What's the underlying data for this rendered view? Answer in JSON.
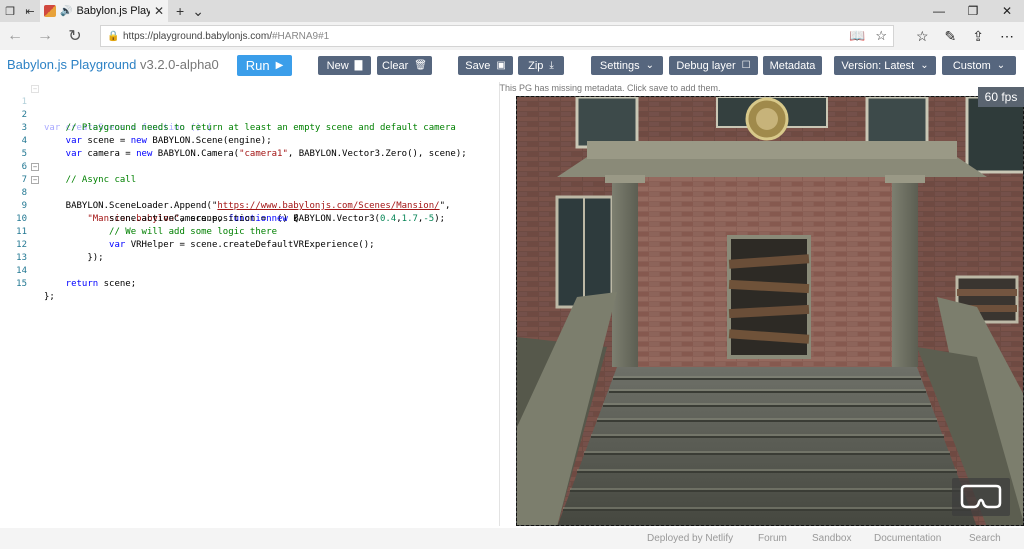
{
  "browser": {
    "tab_title": "Babylon.js Playgrou",
    "url_host": "https://playground.babylonjs.com/",
    "url_path": "#HARNA9#1"
  },
  "toolbar": {
    "brand": "Babylon.js Playground",
    "version": "v3.2.0-alpha0",
    "run_label": "Run",
    "new_label": "New",
    "clear_label": "Clear",
    "save_label": "Save",
    "zip_label": "Zip",
    "settings_label": "Settings",
    "debug_label": "Debug layer",
    "metadata_label": "Metadata",
    "version_select": "Version: Latest",
    "custom_select": "Custom"
  },
  "notice": "This PG has missing metadata. Click save to add them.",
  "fps": "60 fps",
  "editor": {
    "line_numbers": [
      "1",
      "2",
      "3",
      "4",
      "5",
      "6",
      "7",
      "8",
      "9",
      "10",
      "11",
      "12",
      "13",
      "14",
      "15"
    ],
    "l1": "var createScene = function () {",
    "l2": "    // Playground needs to return at least an empty scene and default camera",
    "l3_a": "    var",
    "l3_b": " scene = ",
    "l3_c": "new",
    "l3_d": " BABYLON.Scene(engine);",
    "l4_a": "    var",
    "l4_b": " camera = ",
    "l4_c": "new",
    "l4_d": " BABYLON.Camera(",
    "l4_e": "\"camera1\"",
    "l4_f": ", BABYLON.Vector3.Zero(), scene);",
    "l6": "    // Async call",
    "l7_a": "    BABYLON.SceneLoader.Append(\"",
    "l7_b": "https://www.babylonjs.com/Scenes/Mansion/",
    "l7_c": "\",",
    "l8_a": "        \"Mansion.babylon\"",
    "l8_b": ", scene, ",
    "l8_c": "function",
    "l8_d": " () {",
    "l9_a": "            scene.activeCamera.position = ",
    "l9_b": "new",
    "l9_c": " BABYLON.Vector3(",
    "l9_d": "0.4",
    "l9_e": ",",
    "l9_f": "1.7",
    "l9_g": ",",
    "l9_h": "-5",
    "l9_i": ");",
    "l10": "            // We will add some logic there",
    "l11_a": "            var",
    "l11_b": " VRHelper = scene.createDefaultVRExperience();",
    "l12": "        });",
    "l14_a": "    return",
    "l14_b": " scene;",
    "l15": "};"
  },
  "footer": {
    "deployed": "Deployed by Netlify",
    "forum": "Forum",
    "sandbox": "Sandbox",
    "documentation": "Documentation",
    "search": "Search"
  },
  "colors": {
    "brand": "#2d82c5",
    "run_button": "#3b9eea",
    "toolbar_button": "#56667e",
    "comment": "#008000",
    "keyword": "#0000ff",
    "string": "#a31515",
    "number": "#098658"
  }
}
